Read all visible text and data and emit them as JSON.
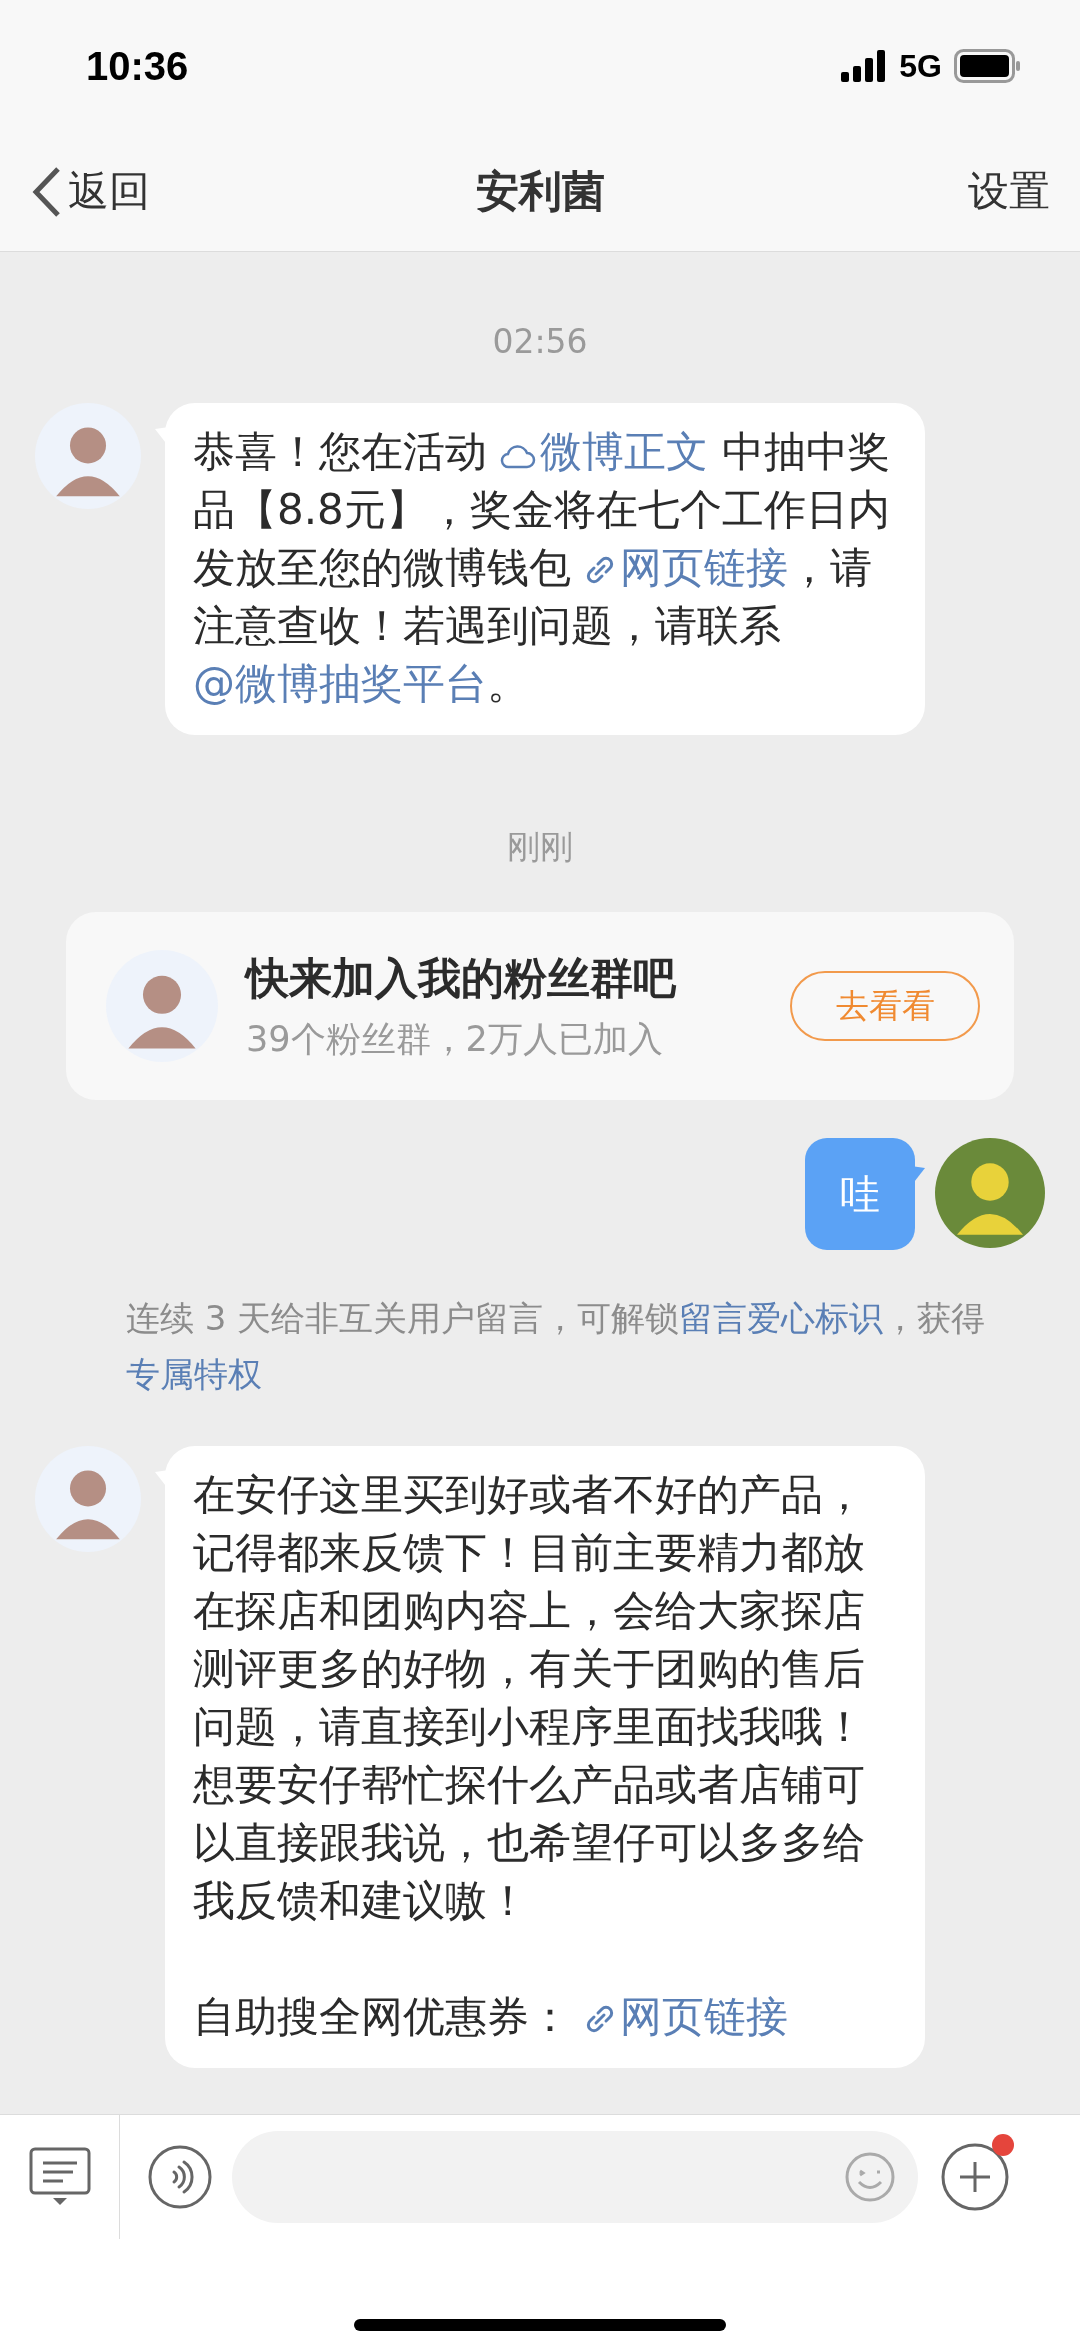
{
  "status_bar": {
    "time": "10:36",
    "network": "5G"
  },
  "nav": {
    "back": "返回",
    "title": "安利菌",
    "action": "设置"
  },
  "messages": [
    {
      "kind": "timestamp",
      "text": "02:56"
    },
    {
      "kind": "incoming",
      "paragraphs": [
        [
          {
            "kind": "text",
            "text": "恭喜！您在活动 "
          },
          {
            "kind": "topic-link",
            "text": "微博正文"
          },
          {
            "kind": "text",
            "text": " 中抽中奖品【8.8元】，奖金将在七个工作日内发放至您的微博钱包 "
          },
          {
            "kind": "web-link",
            "text": "网页链接"
          },
          {
            "kind": "text",
            "text": "，请注意查收！若遇到问题，请联系 "
          },
          {
            "kind": "mention-link",
            "text": "@微博抽奖平台"
          },
          {
            "kind": "text",
            "text": "。"
          }
        ]
      ]
    },
    {
      "kind": "timestamp",
      "text": "刚刚"
    },
    {
      "kind": "card",
      "title": "快来加入我的粉丝群吧",
      "subtitle": "39个粉丝群，2万人已加入",
      "button": "去看看"
    },
    {
      "kind": "outgoing",
      "text": "哇"
    },
    {
      "kind": "notice",
      "segments": [
        {
          "kind": "text",
          "text": "连续 3 天给非互关用户留言，可解锁"
        },
        {
          "kind": "link",
          "text": "留言爱心标识"
        },
        {
          "kind": "text",
          "text": "，获得"
        },
        {
          "kind": "link",
          "text": "专属特权"
        }
      ]
    },
    {
      "kind": "incoming",
      "paragraphs": [
        [
          {
            "kind": "text",
            "text": "在安仔这里买到好或者不好的产品，记得都来反馈下！目前主要精力都放在探店和团购内容上，会给大家探店测评更多的好物，有关于团购的售后问题，请直接到小程序里面找我哦！想要安仔帮忙探什么产品或者店铺可以直接跟我说，也希望仔可以多多给我反馈和建议嗷！"
          }
        ],
        [
          {
            "kind": "text",
            "text": "自助搜全网优惠券： "
          },
          {
            "kind": "web-link",
            "text": "网页链接"
          }
        ]
      ]
    }
  ],
  "input_bar": {
    "plus_badge": true
  }
}
